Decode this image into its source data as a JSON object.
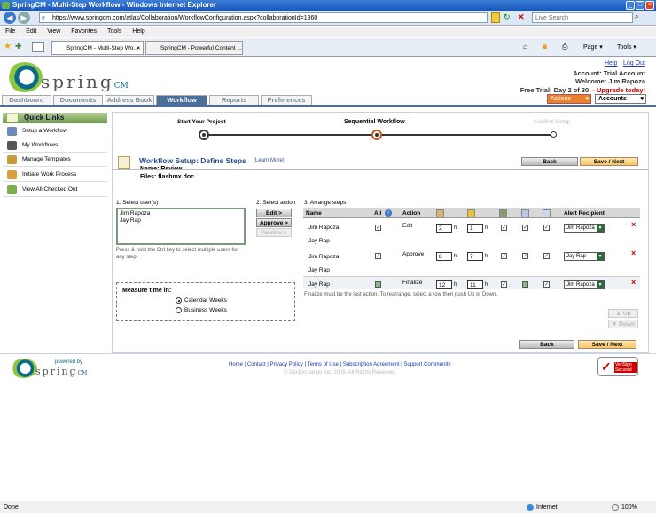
{
  "window": {
    "title": "SpringCM - Multi-Step Workflow - Windows Internet Explorer"
  },
  "browser": {
    "url": "https://www.springcm.com/atlas/Collaboration/WorkflowConfiguration.aspx?collaborationId=1860",
    "search_placeholder": "Live Search",
    "menu": [
      "File",
      "Edit",
      "View",
      "Favorites",
      "Tools",
      "Help"
    ],
    "tabs": [
      "SpringCM - Multi-Step Wo...",
      "SpringCM - Powerful Content ..."
    ],
    "page_label": "Page",
    "tools_label": "Tools"
  },
  "header": {
    "brand": "spring",
    "brand_cm": "CM",
    "help": "Help",
    "logout": "Log Out",
    "account_line": "Account: Trial Account",
    "welcome_line": "Welcome: Jim Rapoza",
    "trial_text": "Free Trial: Day 2 of 30.",
    "upgrade_text": "- Upgrade today!",
    "actions_select": "Actions",
    "accounts_select": "Accounts"
  },
  "nav": [
    "Dashboard",
    "Documents",
    "Address Book",
    "Workflow",
    "Reports",
    "Preferences"
  ],
  "quick_links": {
    "title": "Quick Links",
    "items": [
      "Setup a Workflow",
      "My Workflows",
      "Manage Templates",
      "Initiate Work Process",
      "View All Checked Out"
    ]
  },
  "steps": {
    "start": "Start Your Project",
    "middle": "Sequential Workflow",
    "end": "Confirm Setup"
  },
  "setup": {
    "title": "Workflow Setup: Define Steps",
    "learn_more": "(Learn More)",
    "name_line": "Name: Review",
    "files_line": "Files: flashmx.doc",
    "back": "Back",
    "save_next": "Save / Next"
  },
  "select_users": {
    "label": "1. Select user(s)",
    "users": [
      "Jim Rapoza",
      "Jay Rap"
    ],
    "hint": "Press & hold the Ctrl key to select multiple users for any step."
  },
  "select_action": {
    "label": "2. Select action",
    "buttons": [
      "Edit >",
      "Approve >",
      "Finalize >"
    ]
  },
  "measure": {
    "title": "Measure time in:",
    "options": [
      "Calendar Weeks",
      "Business Weeks"
    ]
  },
  "arrange": {
    "label": "3. Arrange steps",
    "columns": {
      "name": "Name",
      "all": "All",
      "action": "Action",
      "alert": "Alert Recipient"
    },
    "rows": [
      {
        "name": "Jim Rapoza",
        "name2": "Jay Rap",
        "action": "Edit",
        "v1": "2",
        "u1": "h",
        "v2": "1",
        "u2": "h",
        "recipient": "Jim Rapoza"
      },
      {
        "name": "Jim Rapoza",
        "name2": "Jay Rap",
        "action": "Approve",
        "v1": "8",
        "u1": "h",
        "v2": "7",
        "u2": "h",
        "recipient": "Jay Rap"
      },
      {
        "name": "Jay Rap",
        "name2": "",
        "action": "Finalize",
        "v1": "12",
        "u1": "h",
        "v2": "11",
        "u2": "h",
        "recipient": "Jim Rapoza"
      }
    ],
    "note": "Finalize must be the last action. To rearrange, select a row then push Up or Down.",
    "up": "Up",
    "down": "Down"
  },
  "footer": {
    "powered_by": "powered by",
    "links": "Home | Contact | Privacy Policy | Terms of Use | Subscription Agreement | Support Community",
    "copyright": "© DocExchange Inc. 2005. All Rights Reserved.",
    "badge": "VeriSign Secured"
  },
  "status": {
    "left": "Done",
    "zone": "Internet",
    "zoom": "100%"
  }
}
